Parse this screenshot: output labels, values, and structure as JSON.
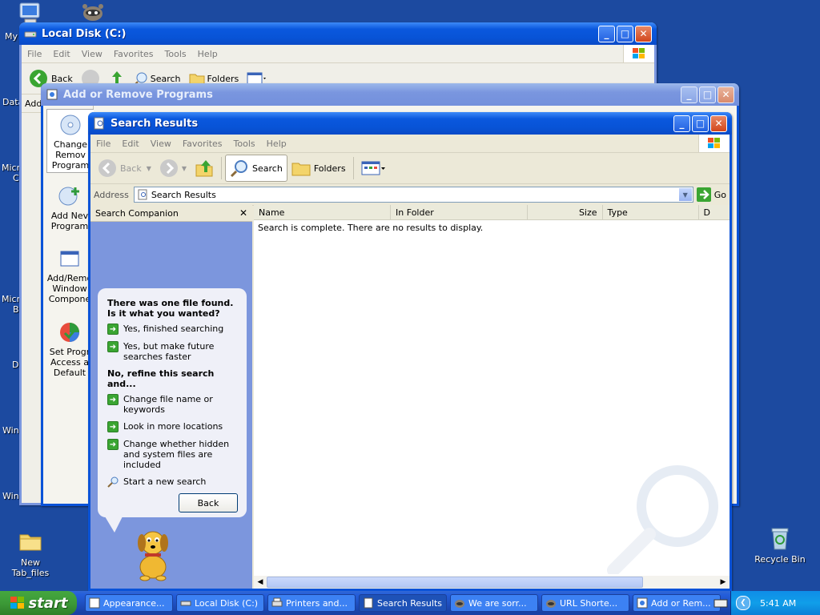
{
  "desktop": {
    "icons": {
      "my_label": "My",
      "data_label": "Data",
      "micro_c_label_1": "Micro",
      "micro_c_label_2": "C",
      "micro_b_label_1": "Micro",
      "micro_b_label_2": "B",
      "d_label": "D",
      "win_label_1": "Win",
      "win_label_2": "Win",
      "new_tab_files": "New Tab_files",
      "recycle_bin": "Recycle Bin"
    }
  },
  "window_local_disk": {
    "title": "Local Disk (C:)",
    "menu": [
      "File",
      "Edit",
      "View",
      "Favorites",
      "Tools",
      "Help"
    ],
    "back": "Back",
    "search": "Search",
    "folders": "Folders",
    "addr_partial": "Add"
  },
  "window_add_remove": {
    "title": "Add or Remove Programs",
    "nav": [
      {
        "l1": "Change",
        "l2": "Remov",
        "l3": "Program"
      },
      {
        "l1": "Add Nev",
        "l2": "Program"
      },
      {
        "l1": "Add/Remo",
        "l2": "Window",
        "l3": "Compone"
      },
      {
        "l1": "Set Progr",
        "l2": "Access a",
        "l3": "Default"
      }
    ]
  },
  "window_search": {
    "title": "Search Results",
    "menu": [
      "File",
      "Edit",
      "View",
      "Favorites",
      "Tools",
      "Help"
    ],
    "toolbar": {
      "back": "Back",
      "search": "Search",
      "folders": "Folders"
    },
    "address_label": "Address",
    "address_value": "Search Results",
    "go": "Go",
    "companion": {
      "title": "Search Companion",
      "question": "There was one file found.  Is it what you wanted?",
      "opt_yes_finished": "Yes, finished searching",
      "opt_yes_faster": "Yes, but make future searches faster",
      "refine_heading": "No, refine this search and...",
      "opt_change_name": "Change file name or keywords",
      "opt_more_locations": "Look in more locations",
      "opt_hidden": "Change whether hidden and system files are included",
      "opt_new_search": "Start a new search",
      "back_button": "Back"
    },
    "columns": [
      "Name",
      "In Folder",
      "Size",
      "Type",
      "D"
    ],
    "status_message": "Search is complete. There are no results to display."
  },
  "taskbar": {
    "start": "start",
    "tasks": [
      "Appearance...",
      "Local Disk (C:)",
      "Printers and...",
      "Search Results",
      "We are sorr...",
      "URL Shorte...",
      "Add or Rem..."
    ],
    "clock": "5:41 AM"
  },
  "colors": {
    "desktop": "#1c4aa0",
    "titlebar_active": "#0853d6",
    "companion_bg": "#7c96dd",
    "start_green": "#3c9a37"
  }
}
